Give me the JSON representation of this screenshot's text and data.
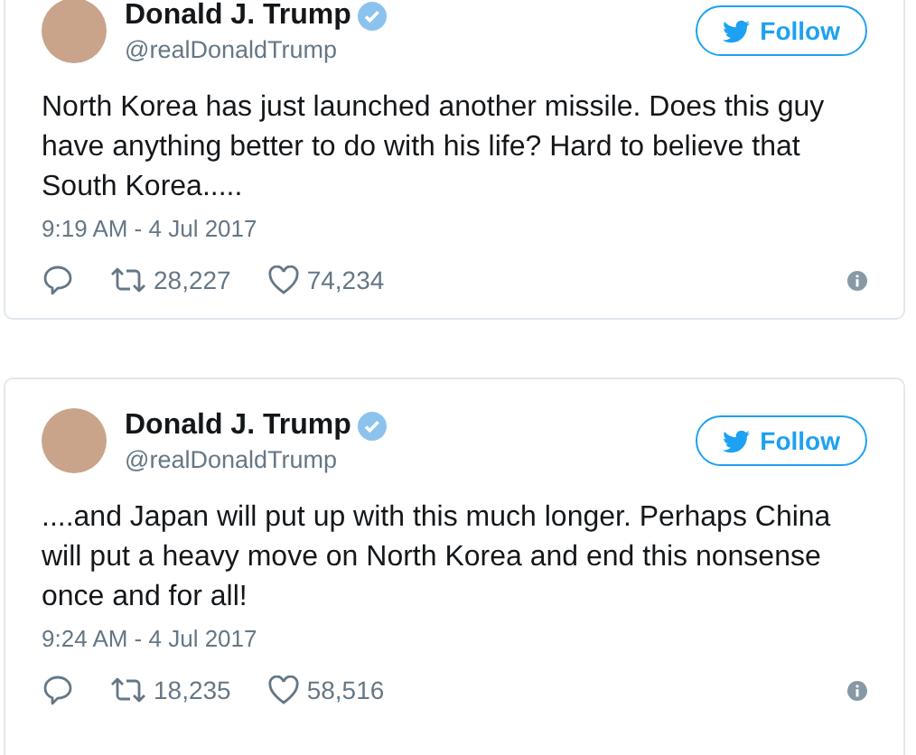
{
  "tweets": [
    {
      "author": {
        "name": "Donald J. Trump",
        "handle": "@realDonaldTrump",
        "verified": true
      },
      "follow_button": "Follow",
      "text": "North Korea has just launched another missile. Does this guy have anything better to do with his life? Hard to believe that South Korea.....",
      "timestamp": "9:19 AM - 4 Jul 2017",
      "retweets": "28,227",
      "likes": "74,234"
    },
    {
      "author": {
        "name": "Donald J. Trump",
        "handle": "@realDonaldTrump",
        "verified": true
      },
      "follow_button": "Follow",
      "text": "....and Japan will put up with this much longer. Perhaps China will put a heavy move on North Korea and end this nonsense once and for all!",
      "timestamp": "9:24 AM - 4 Jul 2017",
      "retweets": "18,235",
      "likes": "58,516"
    }
  ]
}
